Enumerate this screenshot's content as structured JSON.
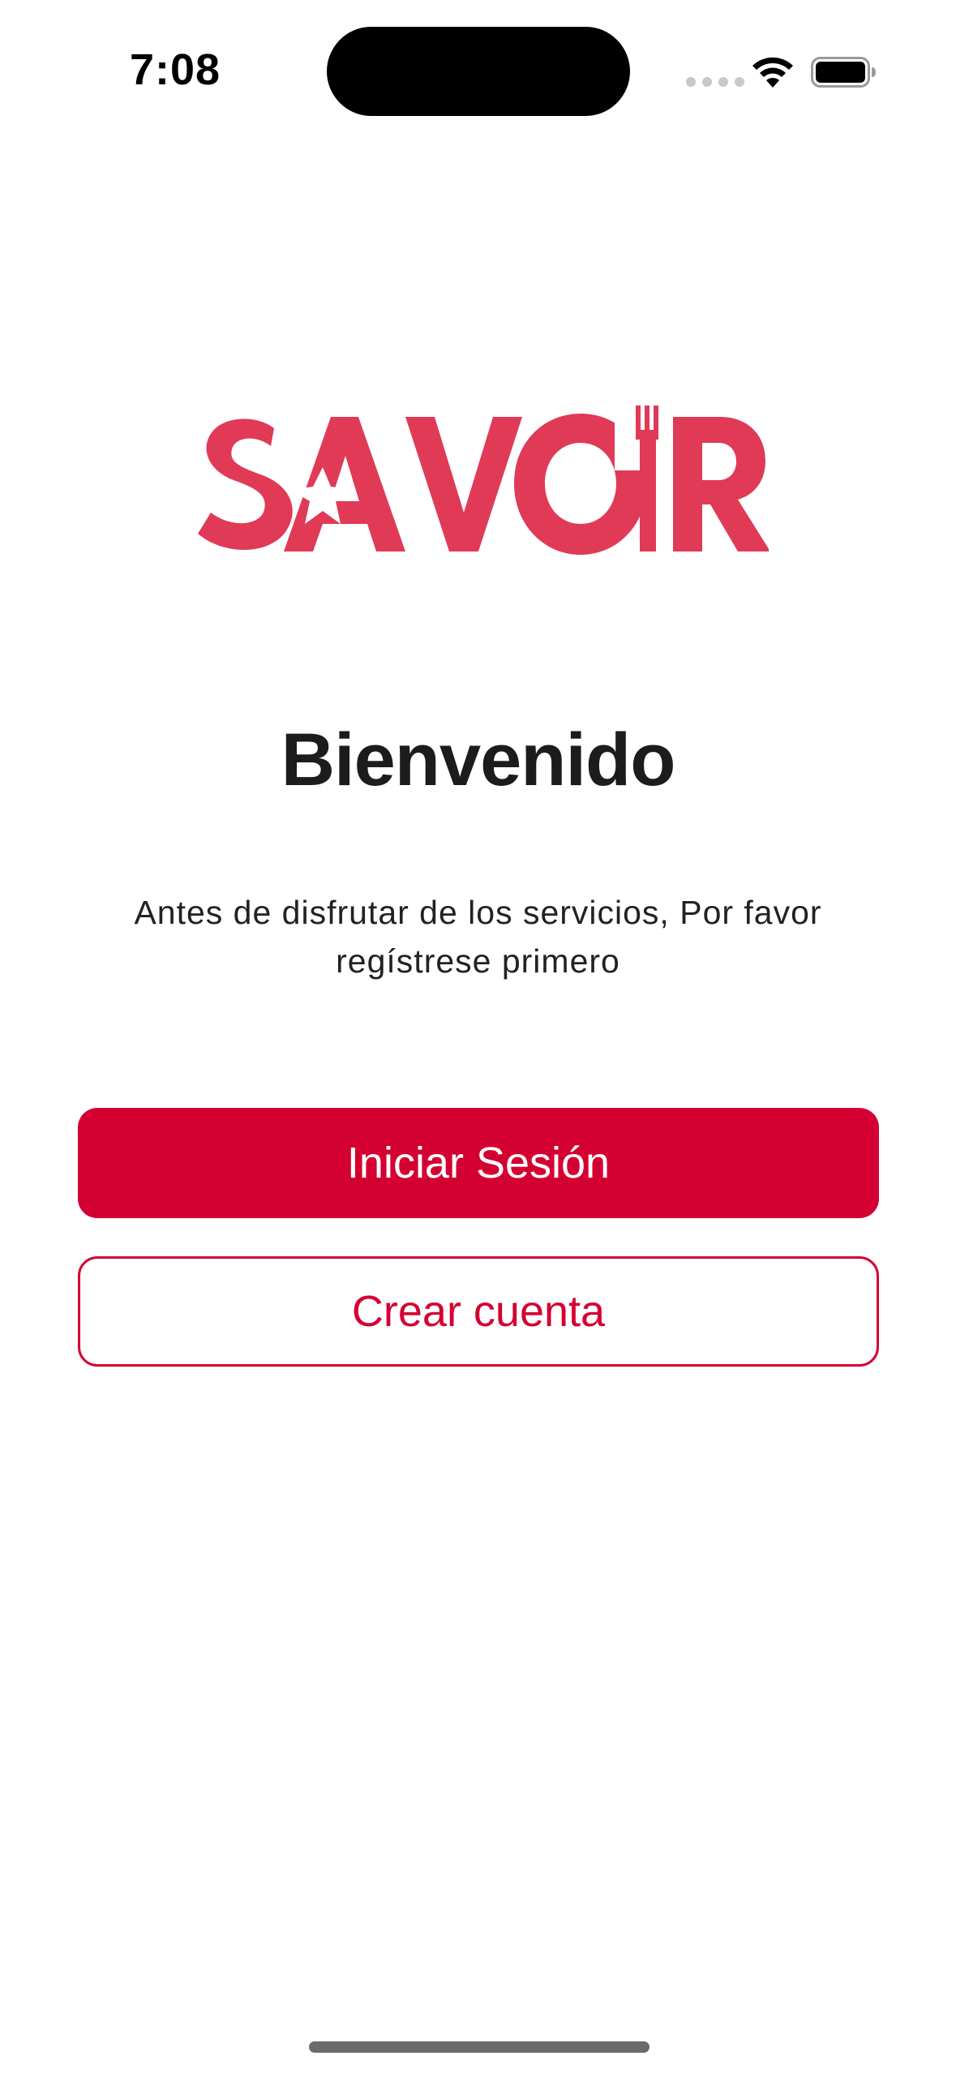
{
  "status_bar": {
    "time": "7:08",
    "icons": [
      "cellular-signal-icon",
      "wifi-icon",
      "battery-icon"
    ]
  },
  "logo": {
    "text": "SAVOIR",
    "color": "#e03a57"
  },
  "welcome": {
    "title": "Bienvenido",
    "subtitle": "Antes de disfrutar de los servicios, Por favor regístrese primero"
  },
  "buttons": {
    "login_label": "Iniciar Sesión",
    "register_label": "Crear cuenta"
  },
  "colors": {
    "accent": "#d50032",
    "text": "#1c1c1e",
    "background": "#ffffff"
  }
}
